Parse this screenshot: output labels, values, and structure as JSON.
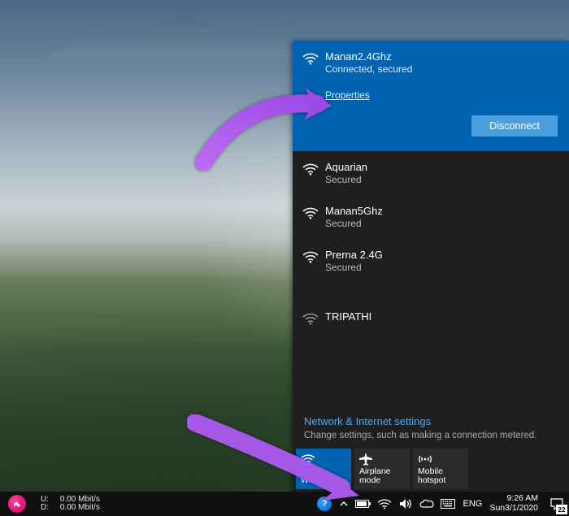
{
  "flyout": {
    "networks": [
      {
        "ssid": "Manan2.4Ghz",
        "status": "Connected, secured",
        "selected": true,
        "secured": true
      },
      {
        "ssid": "Aquarian",
        "status": "Secured",
        "selected": false,
        "secured": true
      },
      {
        "ssid": "Manan5Ghz",
        "status": "Secured",
        "selected": false,
        "secured": true
      },
      {
        "ssid": "Prerna 2.4G",
        "status": "Secured",
        "selected": false,
        "secured": true
      },
      {
        "ssid": "TRIPATHI",
        "status": "",
        "selected": false,
        "secured": false
      }
    ],
    "properties_label": "Properties",
    "disconnect_label": "Disconnect",
    "settings_header": "Network & Internet settings",
    "settings_sub": "Change settings, such as making a connection metered.",
    "tiles": [
      {
        "id": "wifi",
        "label": "Wi-Fi",
        "active": true
      },
      {
        "id": "airplane",
        "label": "Airplane mode",
        "active": false
      },
      {
        "id": "hotspot",
        "label": "Mobile hotspot",
        "active": false
      }
    ]
  },
  "taskbar": {
    "netmon": {
      "up_label": "U:",
      "up_value": "0.00 Mbit/s",
      "down_label": "D:",
      "down_value": "0.00 Mbit/s"
    },
    "ime": "ENG",
    "clock_time": "9:26 AM",
    "clock_date": "Sun3/1/2020",
    "action_center_count": "22"
  },
  "colors": {
    "accent": "#0063b1",
    "link": "#5aa9e6",
    "panel": "#1f1f1f",
    "tile": "#2b2b2b"
  }
}
